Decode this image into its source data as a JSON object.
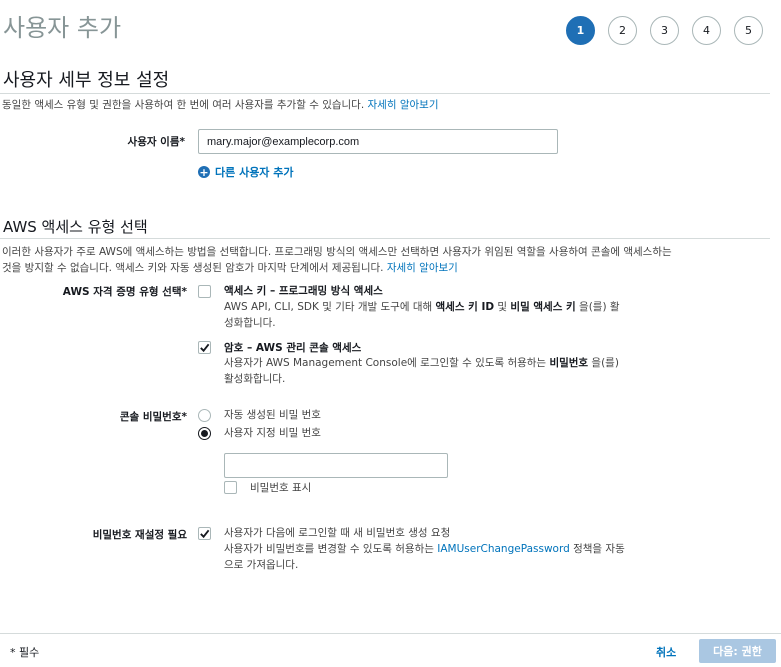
{
  "header": {
    "title": "사용자 추가"
  },
  "steps": [
    "1",
    "2",
    "3",
    "4",
    "5"
  ],
  "user_details": {
    "section_title": "사용자 세부 정보 설정",
    "description": "동일한 액세스 유형 및 권한을 사용하여 한 번에 여러 사용자를 추가할 수 있습니다.",
    "learn_more": "자세히 알아보기",
    "username_label": "사용자 이름*",
    "username_value": "mary.major@examplecorp.com",
    "add_user_label": "다른 사용자 추가"
  },
  "access_type": {
    "section_title": "AWS 액세스 유형 선택",
    "description_line1": "이러한 사용자가 주로 AWS에 액세스하는 방법을 선택합니다. 프로그래밍 방식의 액세스만 선택하면 사용자가 위임된 역할을 사용하여 콘솔에 액세스하는",
    "description_line2": "것을 방지할 수 없습니다. 액세스 키와 자동 생성된 암호가 마지막 단계에서 제공됩니다.",
    "learn_more": "자세히 알아보기",
    "credential_label": "AWS 자격 증명 유형 선택*",
    "programmatic": {
      "title": "액세스 키 – 프로그래밍 방식 액세스",
      "desc_pre": "AWS API, CLI, SDK 및 기타 개발 도구에 대해 ",
      "desc_b1": "액세스 키 ID",
      "desc_mid": " 및 ",
      "desc_b2": "비밀 액세스 키",
      "desc_post": " 을(를) 활",
      "desc_line2": "성화합니다.",
      "checked": false
    },
    "console": {
      "title": "암호 – AWS 관리 콘솔 액세스",
      "desc_pre": "사용자가 AWS Management Console에 로그인할 수 있도록 허용하는 ",
      "desc_b1": "비밀번호",
      "desc_post": " 을(를)",
      "desc_line2": "활성화합니다.",
      "checked": true
    }
  },
  "console_password": {
    "label": "콘솔 비밀번호*",
    "option_auto": "자동 생성된 비밀 번호",
    "option_custom": "사용자 지정 비밀 번호",
    "selected": "custom",
    "password_value": "",
    "show_password_label": "비밀번호 표시"
  },
  "reset_password": {
    "label": "비밀번호 재설정 필요",
    "line1": "사용자가 다음에 로그인할 때 새 비밀번호 생성 요청",
    "line2_pre": "사용자가 비밀번호를 변경할 수 있도록 허용하는 ",
    "line2_link": "IAMUserChangePassword",
    "line2_post": " 정책을 자동",
    "line3": "으로 가져옵니다.",
    "checked": true
  },
  "footer": {
    "required_note": "* 필수",
    "cancel_label": "취소",
    "next_label": "다음: 권한"
  },
  "colors": {
    "accent": "#1f6fb5",
    "link": "#0073bb",
    "next_disabled": "#aac7e2"
  }
}
